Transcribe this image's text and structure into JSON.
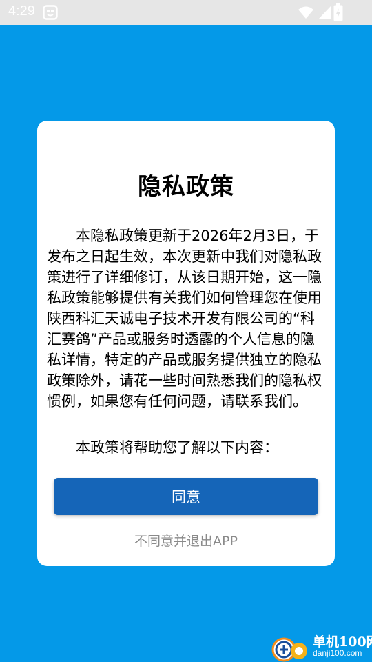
{
  "status_bar": {
    "time": "4:29",
    "icons": [
      "app-notification-icon",
      "wifi-icon",
      "signal-icon",
      "battery-icon"
    ]
  },
  "dialog": {
    "title": "隐私政策",
    "body": "本隐私政策更新于2026年2月3日，于发布之日起生效，本次更新中我们对隐私政策进行了详细修订，从该日期开始，这一隐私政策能够提供有关我们如何管理您在使用陕西科汇天诚电子技术开发有限公司的“科汇赛鸽”产品或服务时透露的个人信息的隐私详情，特定的产品或服务提供独立的隐私政策除外，请花一些时间熟悉我们的隐私权惯例，如果您有任何问题，请联系我们。",
    "intro": "本政策将帮助您了解以下内容：",
    "agree_label": "同意",
    "disagree_label": "不同意并退出APP"
  },
  "watermark": {
    "name": "单机100网",
    "url": "danji100.com"
  },
  "colors": {
    "background": "#0499e8",
    "status_bar": "#e6e6e6",
    "button": "#1565b8",
    "disagree_text": "#8a8a8a"
  }
}
